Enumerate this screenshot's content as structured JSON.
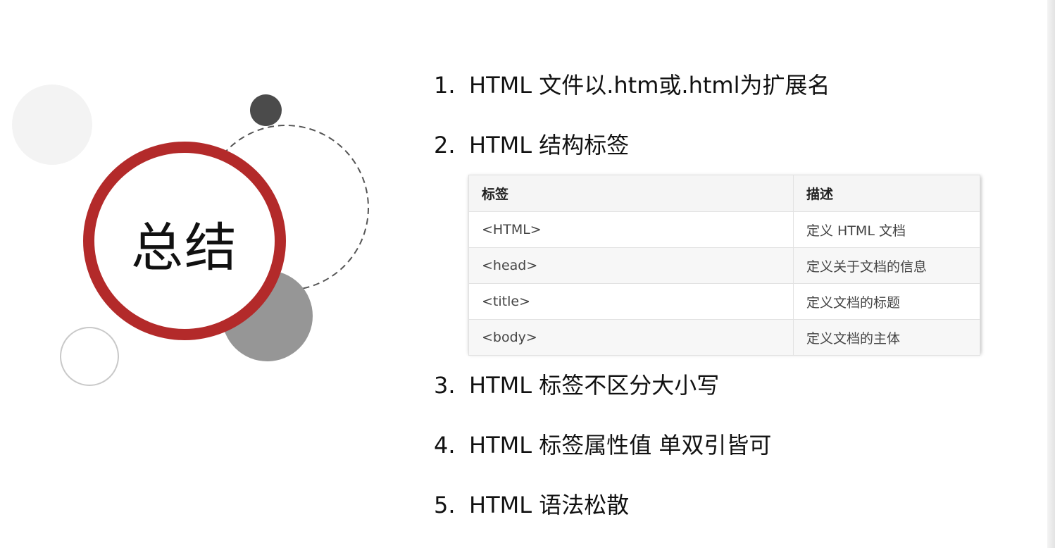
{
  "slide": {
    "title": "总结"
  },
  "items": [
    {
      "number": "1.",
      "text": "HTML 文件以.htm或.html为扩展名"
    },
    {
      "number": "2.",
      "text": "HTML 结构标签"
    },
    {
      "number": "3.",
      "text": "HTML 标签不区分大小写"
    },
    {
      "number": "4.",
      "text": "HTML 标签属性值 单双引皆可"
    },
    {
      "number": "5.",
      "text": "HTML 语法松散"
    }
  ],
  "table": {
    "headers": [
      "标签",
      "描述"
    ],
    "rows": [
      [
        "<HTML>",
        "定义 HTML 文档"
      ],
      [
        "<head>",
        "定义关于文档的信息"
      ],
      [
        "<title>",
        "定义文档的标题"
      ],
      [
        "<body>",
        "定义文档的主体"
      ]
    ]
  },
  "colors": {
    "accent_ring": "#b32a2a",
    "dark_dot": "#4b4b4b",
    "gray_circle": "#969696"
  }
}
